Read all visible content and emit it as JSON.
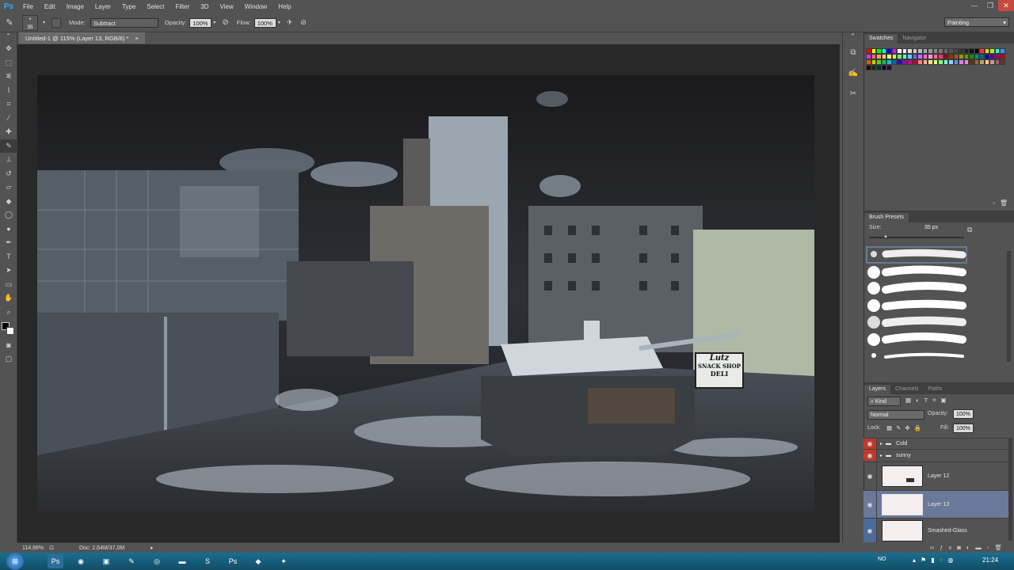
{
  "app": {
    "logo": "Ps",
    "menu": [
      "File",
      "Edit",
      "Image",
      "Layer",
      "Type",
      "Select",
      "Filter",
      "3D",
      "View",
      "Window",
      "Help"
    ],
    "window_controls": [
      "—",
      "❐",
      "✕"
    ]
  },
  "options_bar": {
    "brush_size": "35",
    "mode_label": "Mode:",
    "mode_value": "Subtract",
    "opacity_label": "Opacity:",
    "opacity_value": "100%",
    "flow_label": "Flow:",
    "flow_value": "100%",
    "workspace": "Painting"
  },
  "document": {
    "tab_title": "Untitled-1 @ 115% (Layer 13, RGB/8) *",
    "zoom": "114,66%",
    "doc_size": "Doc: 2,64M/37,0M"
  },
  "canvas_sign": {
    "line1": "Lutz",
    "line2": "SNACK SHOP",
    "line3": "DELI"
  },
  "swatches_panel": {
    "tabs": [
      "Swatches",
      "Navigator"
    ],
    "colors": [
      "#ff0000",
      "#ffff00",
      "#00ff00",
      "#00ffff",
      "#0000ff",
      "#ff00ff",
      "#ffffff",
      "#eeeeee",
      "#dddddd",
      "#cccccc",
      "#bbbbbb",
      "#aaaaaa",
      "#999999",
      "#888888",
      "#777777",
      "#666666",
      "#555555",
      "#444444",
      "#333333",
      "#222222",
      "#111111",
      "#000000",
      "#ff3333",
      "#ffcc00",
      "#99ff33",
      "#33ffcc",
      "#3399ff",
      "#cc33ff",
      "#ff6666",
      "#ff9966",
      "#ffcc66",
      "#ffff66",
      "#ccff66",
      "#66ff66",
      "#66ffcc",
      "#66ccff",
      "#6666ff",
      "#cc66ff",
      "#ff66cc",
      "#ff99cc",
      "#ff6699",
      "#ff3366",
      "#990000",
      "#993300",
      "#996600",
      "#999900",
      "#669900",
      "#009900",
      "#009966",
      "#006699",
      "#000099",
      "#660099",
      "#990066",
      "#cc0000",
      "#cc6600",
      "#cccc00",
      "#66cc00",
      "#00cc66",
      "#00cccc",
      "#0066cc",
      "#3300cc",
      "#9900cc",
      "#cc0099",
      "#cc0033",
      "#ff8080",
      "#ffb380",
      "#ffe680",
      "#e6ff80",
      "#80ff80",
      "#80ffd9",
      "#80d9ff",
      "#8080ff",
      "#d980ff",
      "#ff80d9",
      "#663300",
      "#996633",
      "#cc9966",
      "#ffcc99",
      "#cc9999",
      "#996666",
      "#663333",
      "#330000",
      "#003300",
      "#003333",
      "#000033",
      "#330033"
    ]
  },
  "brush_presets": {
    "title": "Brush Presets",
    "size_label": "Size:",
    "size_value": "35 px"
  },
  "layers_panel": {
    "tabs": [
      "Layers",
      "Channels",
      "Paths"
    ],
    "filter_kind": "Kind",
    "blend_mode": "Normal",
    "opacity_label": "Opacity:",
    "opacity_value": "100%",
    "lock_label": "Lock:",
    "fill_label": "Fill:",
    "fill_value": "100%",
    "groups": [
      {
        "name": "Cold"
      },
      {
        "name": "sunny"
      }
    ],
    "layers": [
      {
        "name": "Layer 12",
        "selected": false
      },
      {
        "name": "Layer 13",
        "selected": true
      },
      {
        "name": "Smashed-Glass",
        "selected": false
      }
    ]
  },
  "taskbar": {
    "language": "NO",
    "clock": "21:24"
  }
}
